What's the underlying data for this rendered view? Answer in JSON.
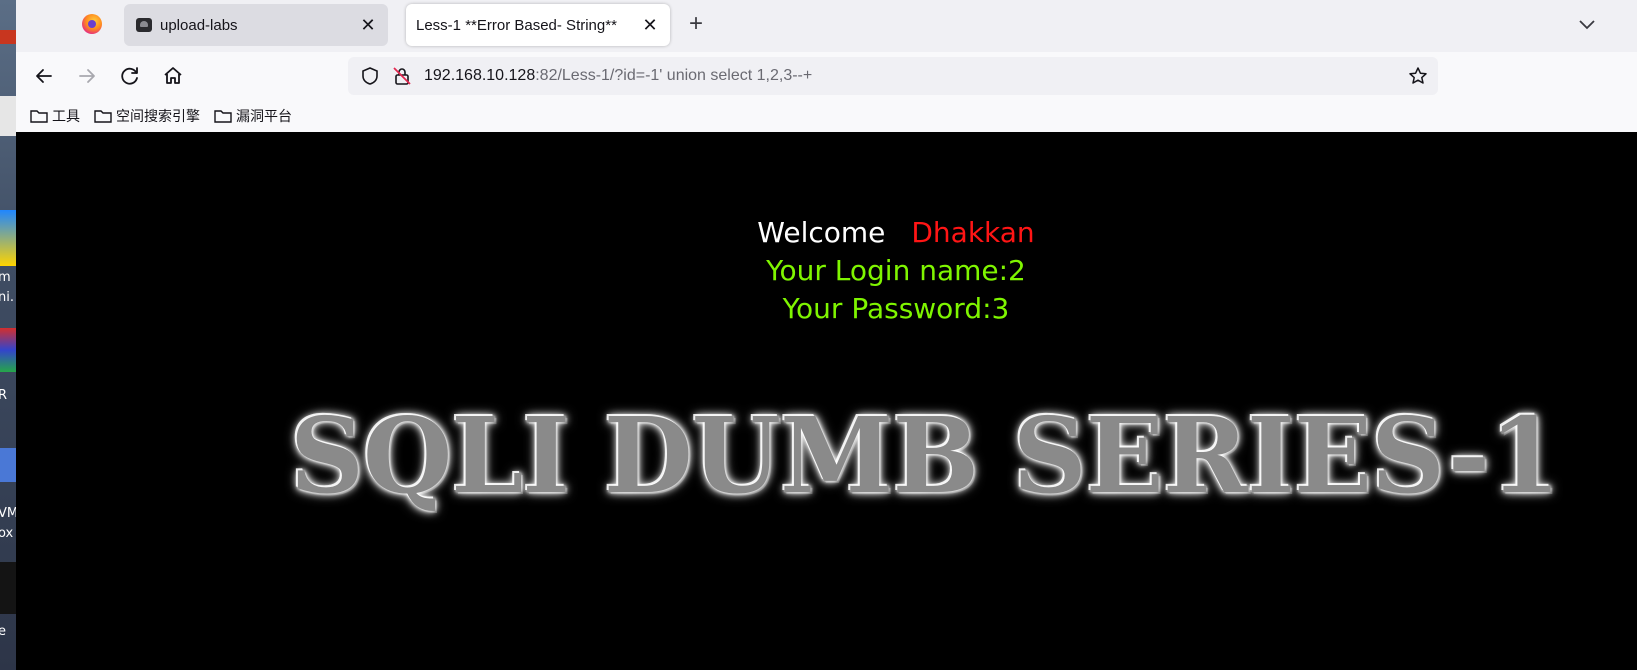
{
  "browser": {
    "tabs": [
      {
        "title": "upload-labs"
      },
      {
        "title": "Less-1 **Error Based- String**"
      }
    ],
    "url_host": "192.168.10.128",
    "url_rest": ":82/Less-1/?id=-1' union select 1,2,3--+",
    "bookmarks": [
      "工具",
      "空间搜索引擎",
      "漏洞平台"
    ]
  },
  "page": {
    "welcome": "Welcome",
    "welcome_name": "Dhakkan",
    "login_line": "Your Login name:2",
    "password_line": "Your Password:3",
    "banner": "SQLI DUMB SERIES-1"
  },
  "colors": {
    "welcome_text": "#ffffff",
    "name_text": "#ff1515",
    "result_text": "#7ff500",
    "page_background": "#000000"
  },
  "desktop_labels": [
    "m",
    "ni.",
    "R",
    "VM",
    "ox",
    "e"
  ]
}
